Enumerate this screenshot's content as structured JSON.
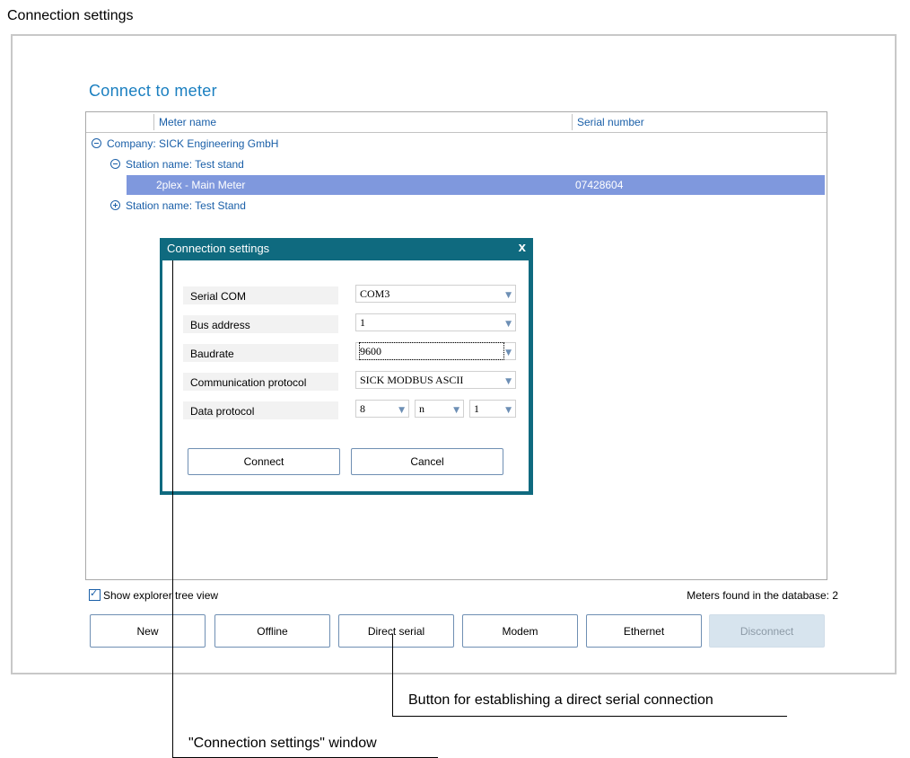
{
  "doc_heading": "Connection settings",
  "main_title": "Connect to meter",
  "table": {
    "columns": [
      "Meter name",
      "Serial number"
    ],
    "rows": {
      "company": "Company: SICK Engineering GmbH",
      "station1": "Station name: Test stand",
      "meter_name": "2plex - Main Meter",
      "meter_serial": "07428604",
      "station2": "Station name: Test Stand"
    }
  },
  "dialog": {
    "title": "Connection settings",
    "close": "x",
    "fields": {
      "serial_com_label": "Serial COM",
      "serial_com_value": "COM3",
      "bus_address_label": "Bus address",
      "bus_address_value": "1",
      "baudrate_label": "Baudrate",
      "baudrate_value": "9600",
      "comm_protocol_label": "Communication protocol",
      "comm_protocol_value": "SICK MODBUS ASCII",
      "data_protocol_label": "Data protocol",
      "data_bits": "8",
      "parity": "n",
      "stop_bits": "1"
    },
    "connect_label": "Connect",
    "cancel_label": "Cancel"
  },
  "show_tree_view": {
    "label": "Show explorer tree view",
    "checked": true
  },
  "meters_found": "Meters found in the database: 2",
  "buttons": {
    "new": "New",
    "offline": "Offline",
    "direct_serial": "Direct serial",
    "modem": "Modem",
    "ethernet": "Ethernet",
    "disconnect": "Disconnect"
  },
  "callouts": {
    "direct_serial": "Button for establishing a direct serial connection",
    "dialog": "\"Connection settings\"  window"
  },
  "colors": {
    "title_blue": "#1a7fc0",
    "selection": "#7f98dd",
    "dialog_frame": "#0f6a7f",
    "disabled_button": "#d7e4ee"
  }
}
